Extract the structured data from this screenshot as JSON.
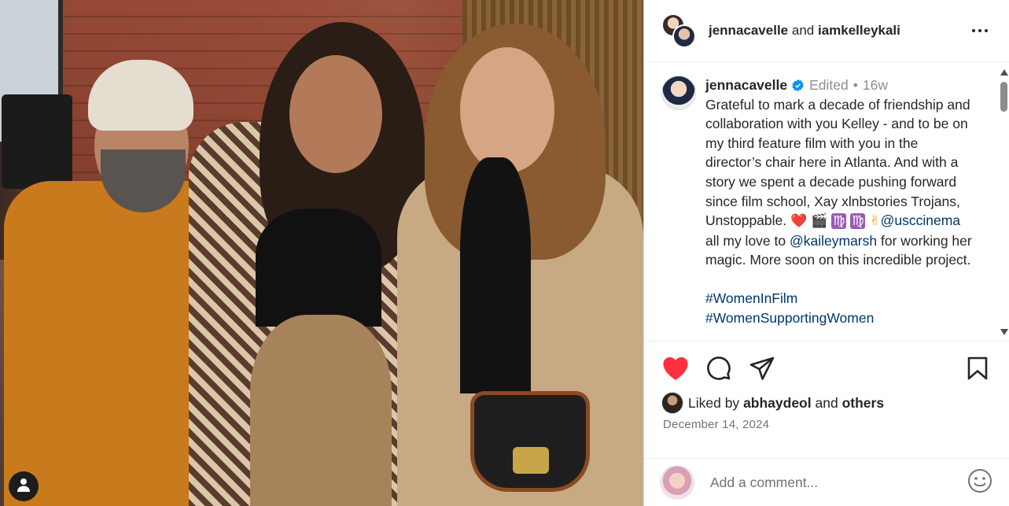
{
  "photo": {
    "user_tag_icon": "person-icon"
  },
  "header": {
    "user1": "jennacavelle",
    "conjunction": "and",
    "user2": "iamkelleykali",
    "more_icon": "more-horizontal-icon"
  },
  "caption": {
    "username": "jennacavelle",
    "edited": "Edited",
    "dot": "•",
    "age": "16w",
    "text_part1": "Grateful to mark a decade of friendship and collaboration with you Kelley - and to be on my third feature film with you in the director’s chair here in Atlanta. And with a story we spent a decade pushing forward since film school, Xay xlnbstories Trojans, Unstoppable. ",
    "emoji_heart": "❤️",
    "emoji_clapper": "🎬",
    "emoji_virgo1": "♍",
    "emoji_virgo2": "♍",
    "emoji_victory": "✌",
    "mention1": "@usccinema",
    "text_part2": " all my love to ",
    "mention2": "@kaileymarsh",
    "text_part3": " for working her magic. More soon on this incredible project.",
    "hashtag1": "#WomenInFilm",
    "hashtag2": "#WomenSupportingWomen"
  },
  "actions": {
    "like_icon": "heart-filled-icon",
    "comment_icon": "comment-icon",
    "share_icon": "send-icon",
    "save_icon": "bookmark-icon",
    "like_color": "#ff3040"
  },
  "likes": {
    "prefix": "Liked by",
    "user": "abhaydeol",
    "conjunction": "and",
    "others": "others"
  },
  "date": "December 14, 2024",
  "add_comment": {
    "placeholder": "Add a comment...",
    "emoji_icon": "emoji-smile-icon"
  },
  "colors": {
    "link": "#00376b",
    "meta": "#8e8e8e",
    "verified": "#0095f6"
  }
}
